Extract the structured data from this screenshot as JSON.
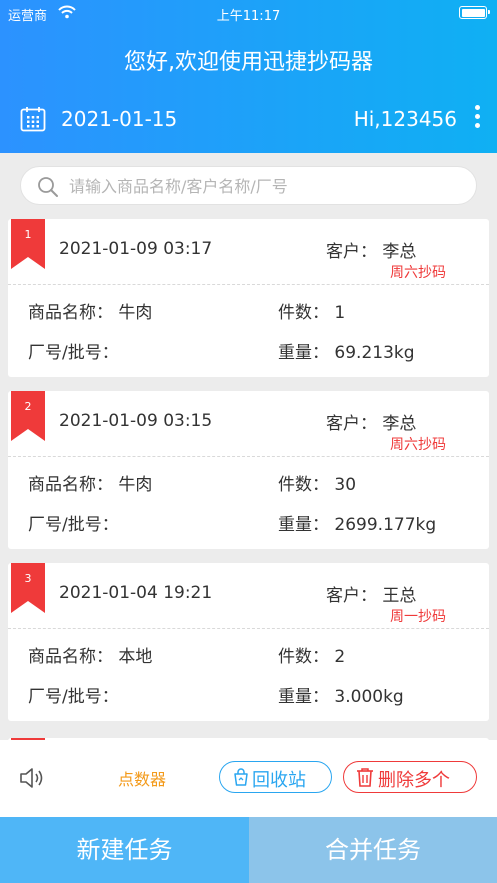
{
  "status_bar": {
    "carrier": "运营商",
    "time": "上午11:17"
  },
  "header": {
    "welcome": "您好,欢迎使用迅捷抄码器",
    "date": "2021-01-15",
    "greeting": "Hi,123456"
  },
  "search": {
    "placeholder": "请输入商品名称/客户名称/厂号",
    "value": ""
  },
  "records": [
    {
      "index": "1",
      "time": "2021-01-09 03:17",
      "customer": "客户： 李总",
      "tag": "周六抄码",
      "name": "商品名称：  牛肉",
      "qty": "件数：  1",
      "batch": "厂号/批号：",
      "weight": "重量：  69.213kg"
    },
    {
      "index": "2",
      "time": "2021-01-09 03:15",
      "customer": "客户： 李总",
      "tag": "周六抄码",
      "name": "商品名称：  牛肉",
      "qty": "件数：  30",
      "batch": "厂号/批号：",
      "weight": "重量：  2699.177kg"
    },
    {
      "index": "3",
      "time": "2021-01-04 19:21",
      "customer": "客户： 王总",
      "tag": "周一抄码",
      "name": "商品名称：  本地",
      "qty": "件数：  2",
      "batch": "厂号/批号：",
      "weight": "重量：  3.000kg"
    }
  ],
  "toolbar": {
    "counter_label": "点数器",
    "recycle_label": "回收站",
    "delete_label": "删除多个"
  },
  "actions": {
    "new_task": "新建任务",
    "merge_task": "合并任务"
  },
  "colors": {
    "header_start": "#2c92ff",
    "header_end": "#0fb0f3",
    "accent_red": "#ef3a3a",
    "accent_blue": "#2aa6f0",
    "accent_orange": "#f39a1a"
  },
  "icons": [
    "wifi-icon",
    "battery-icon",
    "calendar-icon",
    "more-icon",
    "search-icon",
    "ribbon-icon",
    "speaker-icon",
    "recycle-icon",
    "trash-icon"
  ]
}
